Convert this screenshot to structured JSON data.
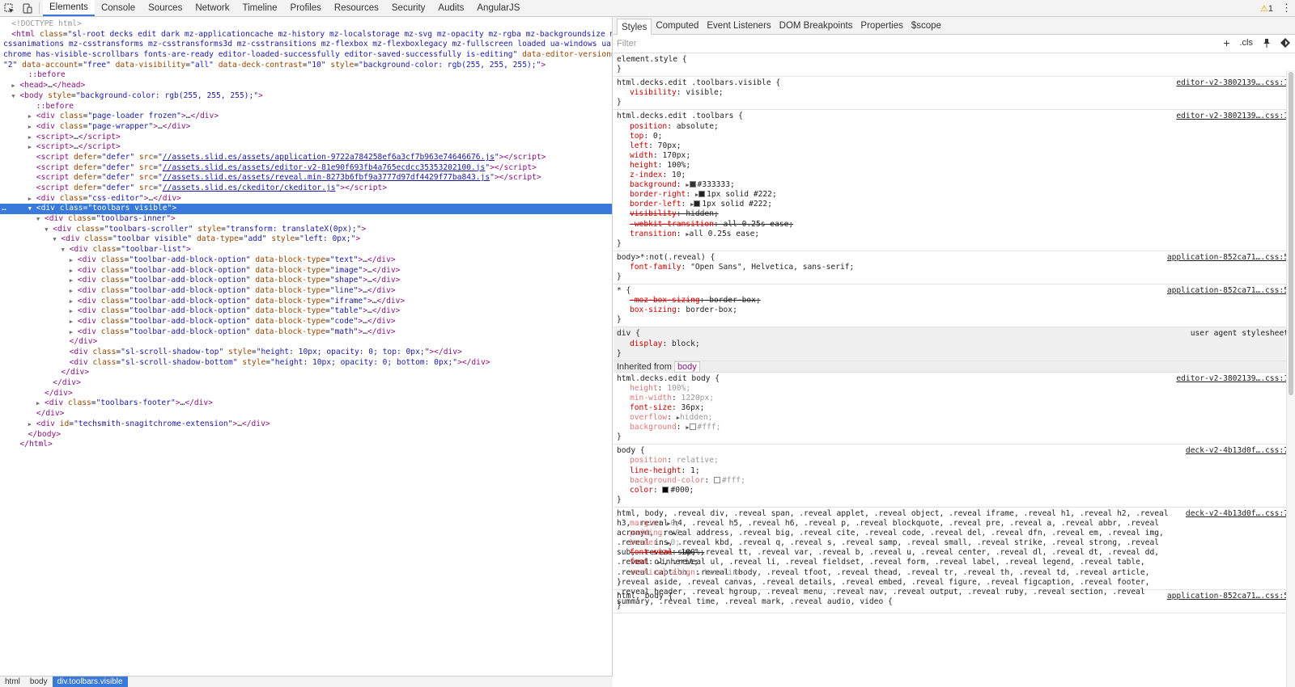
{
  "topbar": {
    "tabs": [
      "Elements",
      "Console",
      "Sources",
      "Network",
      "Timeline",
      "Profiles",
      "Resources",
      "Security",
      "Audits",
      "AngularJS"
    ],
    "active_tab": "Elements",
    "warnings": "1"
  },
  "right_tabs": [
    "Styles",
    "Computed",
    "Event Listeners",
    "DOM Breakpoints",
    "Properties",
    "$scope"
  ],
  "filter_placeholder": "Filter",
  "filter_icons": [
    "+",
    ".cls",
    "pin",
    "palette"
  ],
  "breadcrumbs": [
    "html",
    "body",
    "div.toolbars.visible"
  ],
  "dom_lines": [
    {
      "indent": 1,
      "html": "<span class='cm'>&lt;!DOCTYPE html&gt;</span>"
    },
    {
      "indent": 1,
      "html": "<span class='tg'>&lt;html</span> <span class='an'>class</span>=<span class='av'>\"sl-root decks edit dark mz-applicationcache mz-history mz-localstorage mz-svg mz-opacity mz-rgba mz-backgroundsize mz-</span>"
    },
    {
      "indent": 0,
      "html": "<span class='av'>cssanimations mz-csstransforms mz-csstransforms3d mz-csstransitions mz-flexbox mz-flexboxlegacy mz-fullscreen loaded ua-windows ua-</span>"
    },
    {
      "indent": 0,
      "html": "<span class='av'>chrome has-visible-scrollbars fonts-are-ready editor-loaded-successfully editor-saved-successfully is-editing\"</span> <span class='an'>data-editor-version</span>=</span>"
    },
    {
      "indent": 0,
      "html": "<span class='av'>\"2\"</span> <span class='an'>data-account</span>=<span class='av'>\"free\"</span> <span class='an'>data-visibility</span>=<span class='av'>\"all\"</span> <span class='an'>data-deck-contrast</span>=<span class='av'>\"10\"</span> <span class='an'>style</span>=<span class='av'>\"background-color: rgb(255, 255, 255);\"</span><span class='tg'>&gt;</span>"
    },
    {
      "indent": 3,
      "html": "<span class='pseudo'>::before</span>"
    },
    {
      "indent": 2,
      "arrow": "r",
      "html": "<span class='tg'>&lt;head&gt;</span>…<span class='tg'>&lt;/head&gt;</span>"
    },
    {
      "indent": 2,
      "arrow": "d",
      "html": "<span class='tg'>&lt;body</span> <span class='an'>style</span>=<span class='av'>\"background-color: rgb(255, 255, 255);\"</span><span class='tg'>&gt;</span>"
    },
    {
      "indent": 4,
      "html": "<span class='pseudo'>::before</span>"
    },
    {
      "indent": 4,
      "arrow": "r",
      "html": "<span class='tg'>&lt;div</span> <span class='an'>class</span>=<span class='av'>\"page-loader frozen\"</span><span class='tg'>&gt;</span>…<span class='tg'>&lt;/div&gt;</span>"
    },
    {
      "indent": 4,
      "arrow": "r",
      "html": "<span class='tg'>&lt;div</span> <span class='an'>class</span>=<span class='av'>\"page-wrapper\"</span><span class='tg'>&gt;</span>…<span class='tg'>&lt;/div&gt;</span>"
    },
    {
      "indent": 4,
      "arrow": "r",
      "html": "<span class='tg'>&lt;script&gt;</span>…<span class='tg'>&lt;/script&gt;</span>"
    },
    {
      "indent": 4,
      "arrow": "r",
      "html": "<span class='tg'>&lt;script&gt;</span>…<span class='tg'>&lt;/script&gt;</span>"
    },
    {
      "indent": 4,
      "html": "<span class='tg'>&lt;script</span> <span class='an'>defer</span>=<span class='av'>\"defer\"</span> <span class='an'>src</span>=<span class='av'>\"<span class='lnk'>//assets.slid.es/assets/application-9722a784258ef6a3cf7b963e74646676.js</span>\"</span><span class='tg'>&gt;&lt;/script&gt;</span>"
    },
    {
      "indent": 4,
      "html": "<span class='tg'>&lt;script</span> <span class='an'>defer</span>=<span class='av'>\"defer\"</span> <span class='an'>src</span>=<span class='av'>\"<span class='lnk'>//assets.slid.es/assets/editor-v2-81e90f693fb4a765ecdcc35353202100.js</span>\"</span><span class='tg'>&gt;&lt;/script&gt;</span>"
    },
    {
      "indent": 4,
      "html": "<span class='tg'>&lt;script</span> <span class='an'>defer</span>=<span class='av'>\"defer\"</span> <span class='an'>src</span>=<span class='av'>\"<span class='lnk'>//assets.slid.es/assets/reveal.min-8273b6fbf9a3777d97df4429f77ba843.js</span>\"</span><span class='tg'>&gt;&lt;/script&gt;</span>"
    },
    {
      "indent": 4,
      "html": "<span class='tg'>&lt;script</span> <span class='an'>defer</span>=<span class='av'>\"defer\"</span> <span class='an'>src</span>=<span class='av'>\"<span class='lnk'>//assets.slid.es/ckeditor/ckeditor.js</span>\"</span><span class='tg'>&gt;&lt;/script&gt;</span>"
    },
    {
      "indent": 4,
      "arrow": "r",
      "html": "<span class='tg'>&lt;div</span> <span class='an'>class</span>=<span class='av'>\"css-editor\"</span><span class='tg'>&gt;</span>…<span class='tg'>&lt;/div&gt;</span>"
    },
    {
      "indent": 4,
      "arrow": "d",
      "sel": true,
      "html": "<span class='tg'>&lt;div</span> <span class='an'>class</span>=<span class='av'>\"toolbars visible\"</span><span class='tg'>&gt;</span>"
    },
    {
      "indent": 5,
      "arrow": "d",
      "html": "<span class='tg'>&lt;div</span> <span class='an'>class</span>=<span class='av'>\"toolbars-inner\"</span><span class='tg'>&gt;</span>"
    },
    {
      "indent": 6,
      "arrow": "d",
      "html": "<span class='tg'>&lt;div</span> <span class='an'>class</span>=<span class='av'>\"toolbars-scroller\"</span> <span class='an'>style</span>=<span class='av'>\"transform: translateX(0px);\"</span><span class='tg'>&gt;</span>"
    },
    {
      "indent": 7,
      "arrow": "d",
      "html": "<span class='tg'>&lt;div</span> <span class='an'>class</span>=<span class='av'>\"toolbar visible\"</span> <span class='an'>data-type</span>=<span class='av'>\"add\"</span> <span class='an'>style</span>=<span class='av'>\"left: 0px;\"</span><span class='tg'>&gt;</span>"
    },
    {
      "indent": 8,
      "arrow": "d",
      "html": "<span class='tg'>&lt;div</span> <span class='an'>class</span>=<span class='av'>\"toolbar-list\"</span><span class='tg'>&gt;</span>"
    },
    {
      "indent": 9,
      "arrow": "r",
      "html": "<span class='tg'>&lt;div</span> <span class='an'>class</span>=<span class='av'>\"toolbar-add-block-option\"</span> <span class='an'>data-block-type</span>=<span class='av'>\"text\"</span><span class='tg'>&gt;</span>…<span class='tg'>&lt;/div&gt;</span>"
    },
    {
      "indent": 9,
      "arrow": "r",
      "html": "<span class='tg'>&lt;div</span> <span class='an'>class</span>=<span class='av'>\"toolbar-add-block-option\"</span> <span class='an'>data-block-type</span>=<span class='av'>\"image\"</span><span class='tg'>&gt;</span>…<span class='tg'>&lt;/div&gt;</span>"
    },
    {
      "indent": 9,
      "arrow": "r",
      "html": "<span class='tg'>&lt;div</span> <span class='an'>class</span>=<span class='av'>\"toolbar-add-block-option\"</span> <span class='an'>data-block-type</span>=<span class='av'>\"shape\"</span><span class='tg'>&gt;</span>…<span class='tg'>&lt;/div&gt;</span>"
    },
    {
      "indent": 9,
      "arrow": "r",
      "html": "<span class='tg'>&lt;div</span> <span class='an'>class</span>=<span class='av'>\"toolbar-add-block-option\"</span> <span class='an'>data-block-type</span>=<span class='av'>\"line\"</span><span class='tg'>&gt;</span>…<span class='tg'>&lt;/div&gt;</span>"
    },
    {
      "indent": 9,
      "arrow": "r",
      "html": "<span class='tg'>&lt;div</span> <span class='an'>class</span>=<span class='av'>\"toolbar-add-block-option\"</span> <span class='an'>data-block-type</span>=<span class='av'>\"iframe\"</span><span class='tg'>&gt;</span>…<span class='tg'>&lt;/div&gt;</span>"
    },
    {
      "indent": 9,
      "arrow": "r",
      "html": "<span class='tg'>&lt;div</span> <span class='an'>class</span>=<span class='av'>\"toolbar-add-block-option\"</span> <span class='an'>data-block-type</span>=<span class='av'>\"table\"</span><span class='tg'>&gt;</span>…<span class='tg'>&lt;/div&gt;</span>"
    },
    {
      "indent": 9,
      "arrow": "r",
      "html": "<span class='tg'>&lt;div</span> <span class='an'>class</span>=<span class='av'>\"toolbar-add-block-option\"</span> <span class='an'>data-block-type</span>=<span class='av'>\"code\"</span><span class='tg'>&gt;</span>…<span class='tg'>&lt;/div&gt;</span>"
    },
    {
      "indent": 9,
      "arrow": "r",
      "html": "<span class='tg'>&lt;div</span> <span class='an'>class</span>=<span class='av'>\"toolbar-add-block-option\"</span> <span class='an'>data-block-type</span>=<span class='av'>\"math\"</span><span class='tg'>&gt;</span>…<span class='tg'>&lt;/div&gt;</span>"
    },
    {
      "indent": 8,
      "html": "<span class='tg'>&lt;/div&gt;</span>"
    },
    {
      "indent": 8,
      "html": "<span class='tg'>&lt;div</span> <span class='an'>class</span>=<span class='av'>\"sl-scroll-shadow-top\"</span> <span class='an'>style</span>=<span class='av'>\"height: 10px; opacity: 0; top: 0px;\"</span><span class='tg'>&gt;&lt;/div&gt;</span>"
    },
    {
      "indent": 8,
      "html": "<span class='tg'>&lt;div</span> <span class='an'>class</span>=<span class='av'>\"sl-scroll-shadow-bottom\"</span> <span class='an'>style</span>=<span class='av'>\"height: 10px; opacity: 0; bottom: 0px;\"</span><span class='tg'>&gt;&lt;/div&gt;</span>"
    },
    {
      "indent": 7,
      "html": "<span class='tg'>&lt;/div&gt;</span>"
    },
    {
      "indent": 6,
      "html": "<span class='tg'>&lt;/div&gt;</span>"
    },
    {
      "indent": 5,
      "html": "<span class='tg'>&lt;/div&gt;</span>"
    },
    {
      "indent": 5,
      "arrow": "r",
      "html": "<span class='tg'>&lt;div</span> <span class='an'>class</span>=<span class='av'>\"toolbars-footer\"</span><span class='tg'>&gt;</span>…<span class='tg'>&lt;/div&gt;</span>"
    },
    {
      "indent": 4,
      "html": "<span class='tg'>&lt;/div&gt;</span>"
    },
    {
      "indent": 4,
      "arrow": "r",
      "html": "<span class='tg'>&lt;div</span> <span class='an'>id</span>=<span class='av'>\"techsmith-snagitchrome-extension\"</span><span class='tg'>&gt;</span>…<span class='tg'>&lt;/div&gt;</span>"
    },
    {
      "indent": 3,
      "html": "<span class='tg'>&lt;/body&gt;</span>"
    },
    {
      "indent": 2,
      "html": "<span class='tg'>&lt;/html&gt;</span>"
    }
  ],
  "styles": {
    "inherited_label": "Inherited from",
    "inherited_from": "body",
    "rules": [
      {
        "selector": "element.style {",
        "lines": [],
        "src": ""
      },
      {
        "selector": "html.decks.edit .toolbars.visible {",
        "src": "editor-v2-3802139….css:1",
        "lines": [
          {
            "n": "visibility",
            "v": "visible;"
          }
        ]
      },
      {
        "selector": "html.decks.edit .toolbars {",
        "src": "editor-v2-3802139….css:1",
        "lines": [
          {
            "n": "position",
            "v": "absolute;"
          },
          {
            "n": "top",
            "v": "0;"
          },
          {
            "n": "left",
            "v": "70px;"
          },
          {
            "n": "width",
            "v": "170px;"
          },
          {
            "n": "height",
            "v": "100%;"
          },
          {
            "n": "z-index",
            "v": "10;"
          },
          {
            "n": "background",
            "v": "#333333;",
            "sw": "#333333",
            "tri": true
          },
          {
            "n": "border-right",
            "v": "1px solid #222;",
            "sw": "#222222",
            "tri": true
          },
          {
            "n": "border-left",
            "v": "1px solid #222;",
            "sw": "#222222",
            "tri": true
          },
          {
            "n": "visibility",
            "v": "hidden;",
            "strike": true
          },
          {
            "n": "-webkit-transition",
            "v": "all 0.25s ease;",
            "strike": true,
            "ease": true
          },
          {
            "n": "transition",
            "v": "all 0.25s ease;",
            "tri": true,
            "ease": true
          }
        ]
      },
      {
        "selector": "body>*:not(.reveal) {",
        "src": "application-852ca71….css:5",
        "lines": [
          {
            "n": "font-family",
            "v": "\"Open Sans\", Helvetica, sans-serif;"
          }
        ]
      },
      {
        "selector": "* {",
        "src": "application-852ca71….css:5",
        "lines": [
          {
            "n": "-moz-box-sizing",
            "v": "border-box;",
            "strike": true
          },
          {
            "n": "box-sizing",
            "v": "border-box;"
          }
        ]
      },
      {
        "selector": "div {",
        "src": "user agent stylesheet",
        "ua": true,
        "lines": [
          {
            "n": "display",
            "v": "block;",
            "ua": true
          }
        ]
      },
      {
        "inherited": true
      },
      {
        "selector": "html.decks.edit body {",
        "src": "editor-v2-3802139….css:1",
        "lines": [
          {
            "n": "height",
            "v": "100%;",
            "dim": true
          },
          {
            "n": "min-width",
            "v": "1220px;",
            "dim": true
          },
          {
            "n": "font-size",
            "v": "36px;"
          },
          {
            "n": "overflow",
            "v": "hidden;",
            "dim": true,
            "tri": true
          },
          {
            "n": "background",
            "v": "#fff;",
            "dim": true,
            "tri": true,
            "sw": "#ffffff"
          }
        ]
      },
      {
        "selector": "body {",
        "src": "deck-v2-4b13d0f….css:7",
        "lines": [
          {
            "n": "position",
            "v": "relative;",
            "dim": true
          },
          {
            "n": "line-height",
            "v": "1;"
          },
          {
            "n": "background-color",
            "v": "#fff;",
            "dim": true,
            "sw": "#ffffff"
          },
          {
            "n": "color",
            "v": "#000;",
            "sw": "#000000"
          }
        ]
      },
      {
        "selector": "html, body, .reveal div, .reveal span, .reveal applet, .reveal object, .reveal iframe, .reveal h1, .reveal h2, .reveal h3, .reveal h4, .reveal h5, .reveal h6, .reveal p, .reveal blockquote, .reveal pre, .reveal a, .reveal abbr, .reveal acronym, .reveal address, .reveal big, .reveal cite, .reveal code, .reveal del, .reveal dfn, .reveal em, .reveal img, .reveal ins, .reveal kbd, .reveal q, .reveal s, .reveal samp, .reveal small, .reveal strike, .reveal strong, .reveal sub, .reveal sup, .reveal tt, .reveal var, .reveal b, .reveal u, .reveal center, .reveal dl, .reveal dt, .reveal dd, .reveal ol, .reveal ul, .reveal li, .reveal fieldset, .reveal form, .reveal label, .reveal legend, .reveal table, .reveal caption, .reveal tbody, .reveal tfoot, .reveal thead, .reveal tr, .reveal th, .reveal td, .reveal article, .reveal aside, .reveal canvas, .reveal details, .reveal embed, .reveal figure, .reveal figcaption, .reveal footer, .reveal header, .reveal hgroup, .reveal menu, .reveal nav, .reveal output, .reveal ruby, .reveal section, .reveal summary, .reveal time, .reveal mark, .reveal audio, video {",
        "wrap": true,
        "src": "deck-v2-4b13d0f….css:7",
        "lines": [
          {
            "n": "margin",
            "v": "0;",
            "dim": true,
            "tri": true
          },
          {
            "n": "padding",
            "v": "0;",
            "dim": true,
            "tri": true
          },
          {
            "n": "border",
            "v": "0;",
            "dim": true,
            "tri": true
          },
          {
            "n": "font-size",
            "v": "100%;",
            "strike": true
          },
          {
            "n": "font",
            "v": "inherit;",
            "tri": true
          },
          {
            "n": "vertical-align",
            "v": "baseline;",
            "dim": true
          }
        ]
      },
      {
        "selector": "html, body {",
        "src": "application-852ca71….css:5",
        "lines": []
      }
    ]
  }
}
